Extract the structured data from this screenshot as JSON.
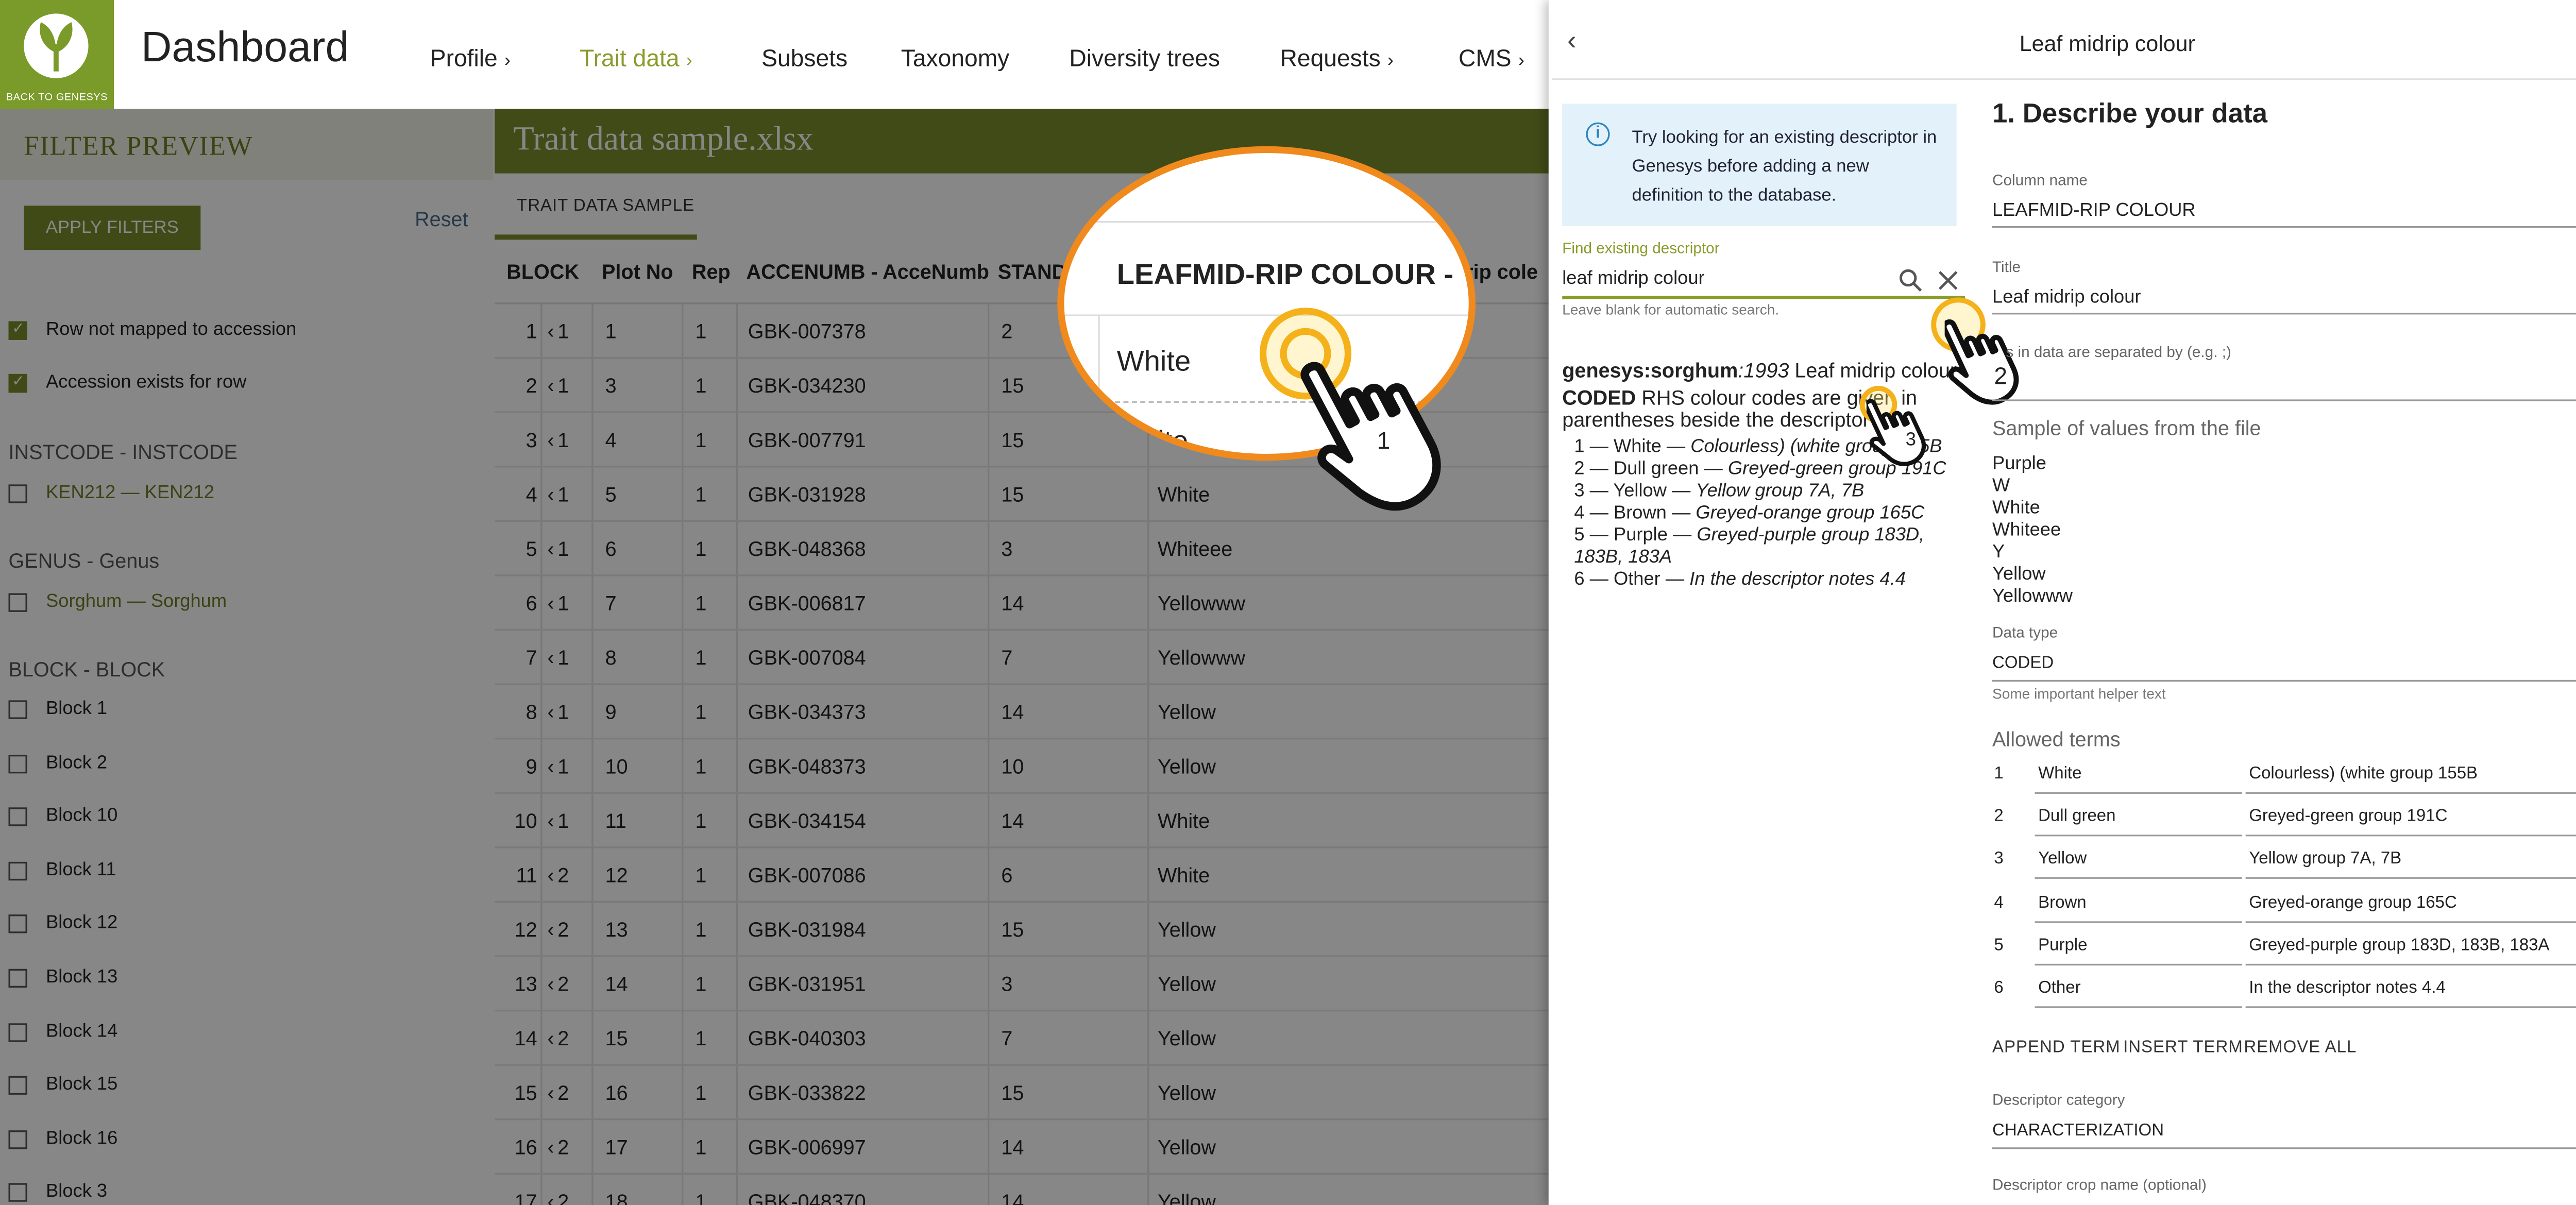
{
  "topbar": {
    "logo_caption": "BACK TO GENESYS",
    "title": "Dashboard",
    "nav": [
      {
        "label": "Profile",
        "chevron": "›",
        "active": false
      },
      {
        "label": "Trait data",
        "chevron": "›",
        "active": true
      },
      {
        "label": "Subsets",
        "chevron": "",
        "active": false
      },
      {
        "label": "Taxonomy",
        "chevron": "",
        "active": false
      },
      {
        "label": "Diversity trees",
        "chevron": "",
        "active": false
      },
      {
        "label": "Requests",
        "chevron": "›",
        "active": false
      },
      {
        "label": "CMS",
        "chevron": "›",
        "active": false
      }
    ]
  },
  "filter": {
    "title": "FILTER PREVIEW",
    "apply_label": "APPLY FILTERS",
    "reset_label": "Reset",
    "checks": [
      {
        "label": "Row not mapped to accession",
        "checked": true
      },
      {
        "label": "Accession exists for row",
        "checked": true
      }
    ],
    "instcode_title": "INSTCODE - INSTCODE",
    "instcode_item": "KEN212 — KEN212",
    "genus_title": "GENUS - Genus",
    "genus_item": "Sorghum — Sorghum",
    "block_title": "BLOCK - BLOCK",
    "blocks": [
      "Block 1",
      "Block 2",
      "Block 10",
      "Block 11",
      "Block 12",
      "Block 13",
      "Block 14",
      "Block 15",
      "Block 16",
      "Block 3"
    ]
  },
  "main": {
    "title": "Trait data sample.xlsx",
    "tab": "TRAIT DATA SAMPLE",
    "columns": [
      "BLOCK",
      "Plot No",
      "Rep",
      "ACCENUMB - AcceNumb",
      "STANDT",
      "rip cole"
    ],
    "rows": [
      {
        "idx": "1",
        "block": "1",
        "plot": "1",
        "rep": "1",
        "acc": "GBK-007378",
        "std": "2",
        "col": ""
      },
      {
        "idx": "2",
        "block": "1",
        "plot": "3",
        "rep": "1",
        "acc": "GBK-034230",
        "std": "15",
        "col": ""
      },
      {
        "idx": "3",
        "block": "1",
        "plot": "4",
        "rep": "1",
        "acc": "GBK-007791",
        "std": "15",
        "col": ""
      },
      {
        "idx": "4",
        "block": "1",
        "plot": "5",
        "rep": "1",
        "acc": "GBK-031928",
        "std": "15",
        "col": "White"
      },
      {
        "idx": "5",
        "block": "1",
        "plot": "6",
        "rep": "1",
        "acc": "GBK-048368",
        "std": "3",
        "col": "Whiteee"
      },
      {
        "idx": "6",
        "block": "1",
        "plot": "7",
        "rep": "1",
        "acc": "GBK-006817",
        "std": "14",
        "col": "Yellowww"
      },
      {
        "idx": "7",
        "block": "1",
        "plot": "8",
        "rep": "1",
        "acc": "GBK-007084",
        "std": "7",
        "col": "Yellowww"
      },
      {
        "idx": "8",
        "block": "1",
        "plot": "9",
        "rep": "1",
        "acc": "GBK-034373",
        "std": "14",
        "col": "Yellow"
      },
      {
        "idx": "9",
        "block": "1",
        "plot": "10",
        "rep": "1",
        "acc": "GBK-048373",
        "std": "10",
        "col": "Yellow"
      },
      {
        "idx": "10",
        "block": "1",
        "plot": "11",
        "rep": "1",
        "acc": "GBK-034154",
        "std": "14",
        "col": "White"
      },
      {
        "idx": "11",
        "block": "2",
        "plot": "12",
        "rep": "1",
        "acc": "GBK-007086",
        "std": "6",
        "col": "White"
      },
      {
        "idx": "12",
        "block": "2",
        "plot": "13",
        "rep": "1",
        "acc": "GBK-031984",
        "std": "15",
        "col": "Yellow"
      },
      {
        "idx": "13",
        "block": "2",
        "plot": "14",
        "rep": "1",
        "acc": "GBK-031951",
        "std": "3",
        "col": "Yellow"
      },
      {
        "idx": "14",
        "block": "2",
        "plot": "15",
        "rep": "1",
        "acc": "GBK-040303",
        "std": "7",
        "col": "Yellow"
      },
      {
        "idx": "15",
        "block": "2",
        "plot": "16",
        "rep": "1",
        "acc": "GBK-033822",
        "std": "15",
        "col": "Yellow"
      },
      {
        "idx": "16",
        "block": "2",
        "plot": "17",
        "rep": "1",
        "acc": "GBK-006997",
        "std": "14",
        "col": "Yellow"
      },
      {
        "idx": "17",
        "block": "2",
        "plot": "18",
        "rep": "1",
        "acc": "GBK-048370",
        "std": "14",
        "col": "Yellow"
      }
    ]
  },
  "magnifier": {
    "column_title": "LEAFMID-RIP COLOUR -",
    "value": "White",
    "next_value": "ite",
    "step": "1"
  },
  "panel": {
    "title": "Leaf midrip colour",
    "hint": "Try looking for an existing descriptor in Genesys before adding a new definition to the database.",
    "find_label": "Find existing descriptor",
    "find_value": "leaf midrip colour",
    "find_help": "Leave blank for automatic search.",
    "result": {
      "source": "genesys:sorghum",
      "year": ":1993",
      "name": " Leaf midrip colour",
      "coded": "CODED",
      "desc": " RHS colour codes are given in parentheses beside the descriptor",
      "terms": [
        {
          "code": "1 — White — ",
          "note": "Colourless) (white group 155B"
        },
        {
          "code": "2 — Dull green — ",
          "note": "Greyed-green group 191C"
        },
        {
          "code": "3 — Yellow — ",
          "note": "Yellow group 7A, 7B"
        },
        {
          "code": "4 — Brown — ",
          "note": "Greyed-orange group 165C"
        },
        {
          "code": "5 — Purple — ",
          "note": "Greyed-purple group 183D, 183B, 183A"
        },
        {
          "code": "6 — Other — ",
          "note": "In the descriptor notes 4.4"
        }
      ]
    },
    "section_title": "1. Describe your data",
    "column_name_label": "Column name",
    "column_name": "LEAFMID-RIP COLOUR",
    "title_label": "Title",
    "title_value": "Leaf midrip colour",
    "separator_label": "s in data are separated by (e.g. ;)",
    "sample_title": "Sample of values from the file",
    "samples": [
      "Purple",
      "W",
      "White",
      "Whiteee",
      "Y",
      "Yellow",
      "Yellowww"
    ],
    "data_type_label": "Data type",
    "data_type": "CODED",
    "data_type_help": "Some important helper text",
    "allowed_title": "Allowed terms",
    "allowed": [
      {
        "n": "1",
        "term": "White",
        "desc": "Colourless) (white group 155B"
      },
      {
        "n": "2",
        "term": "Dull green",
        "desc": "Greyed-green group 191C"
      },
      {
        "n": "3",
        "term": "Yellow",
        "desc": "Yellow group 7A, 7B"
      },
      {
        "n": "4",
        "term": "Brown",
        "desc": "Greyed-orange group 165C"
      },
      {
        "n": "5",
        "term": "Purple",
        "desc": "Greyed-purple group 183D, 183B, 183A"
      },
      {
        "n": "6",
        "term": "Other",
        "desc": "In the descriptor notes 4.4"
      }
    ],
    "append_label": "APPEND TERM",
    "insert_label": "INSERT TERM",
    "remove_label": "REMOVE ALL",
    "category_label": "Descriptor category",
    "category_value": "CHARACTERIZATION",
    "crop_label": "Descriptor crop name (optional)",
    "step2": "2",
    "step3": "3"
  },
  "colors": {
    "accent": "#7b8e2c",
    "highlight": "#f08a1c",
    "info": "#e3f2fa"
  }
}
